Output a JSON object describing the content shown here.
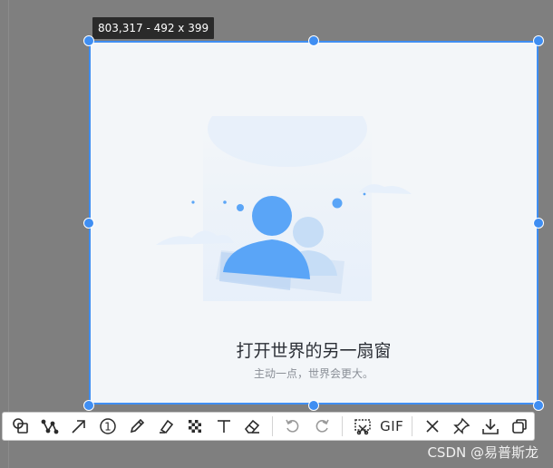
{
  "selection_readout": "803,317 - 492 x 399",
  "content": {
    "title": "打开世界的另一扇窗",
    "subtitle": "主动一点，世界会更大。",
    "illustration_icon": "user-group-icon"
  },
  "toolbar": {
    "tools": [
      {
        "name": "shape-tool",
        "icon": "shapes-icon"
      },
      {
        "name": "polyline-tool",
        "icon": "polyline-icon"
      },
      {
        "name": "arrow-tool",
        "icon": "arrow-icon"
      },
      {
        "name": "number-marker-tool",
        "icon": "number-marker-icon",
        "text": "1"
      },
      {
        "name": "pen-tool",
        "icon": "pencil-icon"
      },
      {
        "name": "highlighter-tool",
        "icon": "highlighter-icon"
      },
      {
        "name": "mosaic-tool",
        "icon": "mosaic-icon"
      },
      {
        "name": "text-tool",
        "icon": "text-icon"
      },
      {
        "name": "eraser-tool",
        "icon": "eraser-icon"
      },
      {
        "name": "undo-button",
        "icon": "undo-icon"
      },
      {
        "name": "redo-button",
        "icon": "redo-icon"
      },
      {
        "name": "long-screenshot-button",
        "icon": "scroll-capture-icon"
      },
      {
        "name": "gif-button",
        "icon": "gif-icon",
        "text": "GIF"
      },
      {
        "name": "cancel-button",
        "icon": "close-icon"
      },
      {
        "name": "pin-button",
        "icon": "pin-icon"
      },
      {
        "name": "save-button",
        "icon": "download-icon"
      },
      {
        "name": "copy-button",
        "icon": "copy-icon"
      }
    ]
  },
  "watermark": "CSDN @易普斯龙",
  "colors": {
    "accent": "#3f8ef2",
    "overlay": "#7f7f7f",
    "selection_bg": "#f3f6f9",
    "illustration": "#5aa5f7"
  }
}
